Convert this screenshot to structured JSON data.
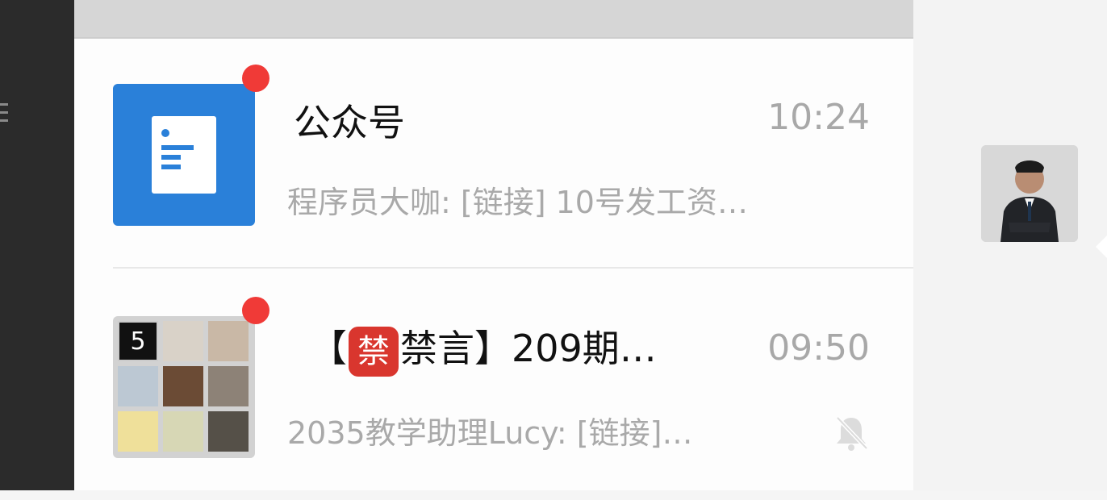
{
  "icons": {
    "menu": "menu-icon",
    "official_accounts": "document-icon",
    "mute": "bell-muted-icon"
  },
  "colors": {
    "badge": "#f03a37",
    "official_account_bg": "#2a80d9",
    "ban_badge": "#d9362e"
  },
  "chats": [
    {
      "name": "公众号",
      "time": "10:24",
      "preview": "程序员大咖: [链接] 10号发工资…",
      "unread": true
    },
    {
      "name_prefix": "【",
      "name_badge": "禁",
      "name_suffix": "禁言】209期…",
      "time": "09:50",
      "preview": "2035教学助理Lucy: [链接]…",
      "unread": true,
      "muted": true,
      "avatar_tile_text": "5"
    }
  ]
}
